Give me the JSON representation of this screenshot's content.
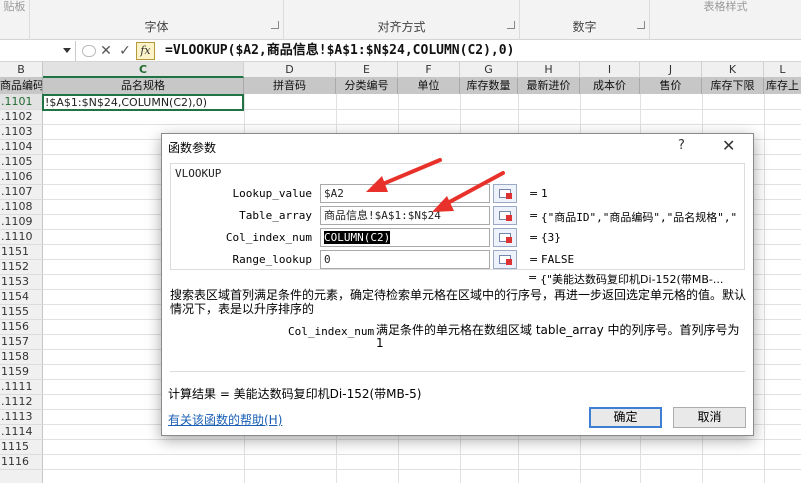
{
  "ribbon": {
    "groups": [
      {
        "top": "贴板",
        "label": ""
      },
      {
        "top": "",
        "label": "字体"
      },
      {
        "top": "",
        "label": "对齐方式"
      },
      {
        "top": "",
        "label": "数字"
      },
      {
        "top": "表格样式",
        "label": ""
      }
    ]
  },
  "formula_bar": {
    "name_box": "",
    "cancel_icon": "✕",
    "enter_icon": "✓",
    "fx": "fx",
    "formula": "=VLOOKUP($A2,商品信息!$A$1:$N$24,COLUMN(C2),0)"
  },
  "grid": {
    "columns": [
      "B",
      "C",
      "D",
      "E",
      "F",
      "G",
      "H",
      "I",
      "J",
      "K",
      "L"
    ],
    "headers": [
      "商品编码",
      "品名规格",
      "拼音码",
      "分类编号",
      "单位",
      "库存数量",
      "最新进价",
      "成本价",
      "售价",
      "库存下限",
      "库存上"
    ],
    "rows": [
      ".1101",
      ".1102",
      ".1103",
      ".1104",
      ".1105",
      ".1106",
      ".1107",
      ".1108",
      ".1109",
      ".1110",
      "1151",
      "1152",
      "1153",
      "1154",
      "1155",
      "1156",
      "1157",
      "1158",
      "1159",
      ".1111",
      ".1112",
      ".1113",
      ".1114",
      "1115",
      "1116"
    ],
    "active_cell_text": "!$A$1:$N$24,COLUMN(C2),0)"
  },
  "dialog": {
    "title": "函数参数",
    "help": "?",
    "close": "✕",
    "function_name": "VLOOKUP",
    "args": [
      {
        "label": "Lookup_value",
        "value": "$A2",
        "result": "1"
      },
      {
        "label": "Table_array",
        "value": "商品信息!$A$1:$N$24",
        "result": "{\"商品ID\",\"商品编码\",\"品名规格\",\""
      },
      {
        "label": "Col_index_num",
        "value": "COLUMN(C2)",
        "result": "{3}"
      },
      {
        "label": "Range_lookup",
        "value": "0",
        "result": "FALSE"
      }
    ],
    "eq": "=",
    "overall_result": "{\"美能达数码复印机Di-152(带MB-...",
    "description": "搜索表区域首列满足条件的元素，确定待检索单元格在区域中的行序号，再进一步返回选定单元格的值。默认情况下，表是以升序排序的",
    "arg_desc_name": "Col_index_num",
    "arg_desc_text": "满足条件的单元格在数组区域 table_array 中的列序号。首列序号为 1",
    "calc_result": "计算结果 = 美能达数码复印机Di-152(带MB-5)",
    "help_link": "有关该函数的帮助(H)",
    "ok": "确定",
    "cancel": "取消"
  },
  "colors": {
    "accent_green": "#217346",
    "annotation_arrow": "#e8312a",
    "link": "#1a5fb4"
  }
}
